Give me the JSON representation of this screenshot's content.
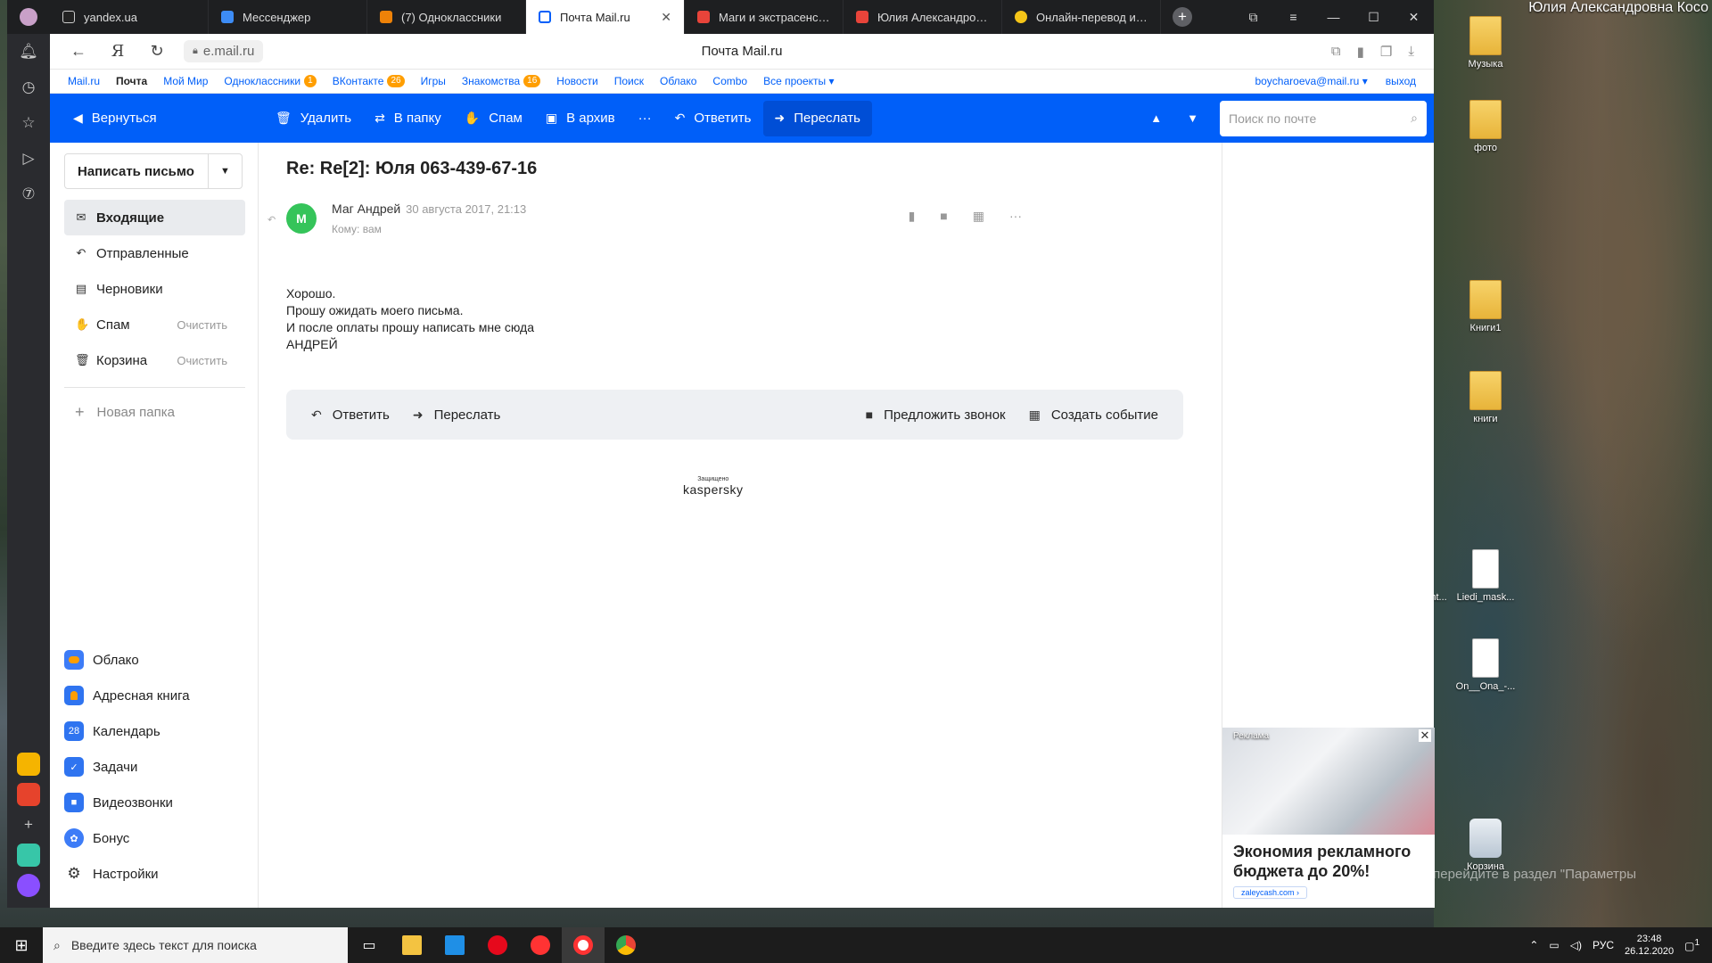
{
  "desktop": {
    "user_name": "Юлия Александровна Косо",
    "watermark": "Windows, перейдите в раздел \"Параметры",
    "icons": [
      {
        "label": "Музыка",
        "kind": "folder"
      },
      {
        "label": "фото",
        "kind": "folder"
      },
      {
        "label": "Книги1",
        "kind": "folder"
      },
      {
        "label": "книги",
        "kind": "folder"
      },
      {
        "label": "Linden_Cht...",
        "kind": "doc"
      },
      {
        "label": "Liedi_mask...",
        "kind": "doc"
      },
      {
        "label": "On__Ona_-...",
        "kind": "doc"
      },
      {
        "label": "Корзина",
        "kind": "bin"
      }
    ]
  },
  "browser": {
    "tabs": [
      {
        "label": "yandex.ua",
        "icon": "page-icon",
        "color": "#ffffff",
        "active": false
      },
      {
        "label": "Мессенджер",
        "icon": "messenger-icon",
        "color": "#3d8cf5",
        "active": false
      },
      {
        "label": "(7) Одноклассники",
        "icon": "ok-icon",
        "color": "#ee8208",
        "active": false
      },
      {
        "label": "Почта Mail.ru",
        "icon": "mail-icon",
        "color": "#005ff9",
        "active": true
      },
      {
        "label": "Маги и экстрасенсы: г",
        "icon": "site-icon",
        "color": "#e8443a",
        "active": false
      },
      {
        "label": "Юлия Александровна",
        "icon": "site-icon",
        "color": "#e8443a",
        "active": false
      },
      {
        "label": "Онлайн-перевод из к",
        "icon": "translate-icon",
        "color": "#f5c518",
        "active": false
      }
    ],
    "tab_close": "✕",
    "new_tab": "+",
    "window_controls": [
      "⧉",
      "≡",
      "—",
      "☐",
      "✕"
    ],
    "url": "e.mail.ru",
    "page_title": "Почта Mail.ru",
    "yandex_logo": "Я"
  },
  "portal": {
    "links": [
      {
        "label": "Mail.ru",
        "badge": ""
      },
      {
        "label": "Почта",
        "badge": "",
        "current": true
      },
      {
        "label": "Мой Мир",
        "badge": ""
      },
      {
        "label": "Одноклассники",
        "badge": "1"
      },
      {
        "label": "ВКонтакте",
        "badge": "26"
      },
      {
        "label": "Игры",
        "badge": ""
      },
      {
        "label": "Знакомства",
        "badge": "16"
      },
      {
        "label": "Новости",
        "badge": ""
      },
      {
        "label": "Поиск",
        "badge": ""
      },
      {
        "label": "Облако",
        "badge": ""
      },
      {
        "label": "Combo",
        "badge": ""
      },
      {
        "label": "Все проекты ▾",
        "badge": ""
      }
    ],
    "user_email": "boycharoeva@mail.ru ▾",
    "logout": "выход"
  },
  "toolbar": {
    "back": "Вернуться",
    "delete": "Удалить",
    "to_folder": "В папку",
    "spam": "Спам",
    "archive": "В архив",
    "more": "···",
    "reply": "Ответить",
    "forward": "Переслать",
    "search_placeholder": "Поиск по почте"
  },
  "sidebar": {
    "compose": "Написать письмо",
    "folders": [
      {
        "label": "Входящие",
        "icon": "inbox-icon",
        "glyph": "✉",
        "action": "",
        "active": true
      },
      {
        "label": "Отправленные",
        "icon": "sent-icon",
        "glyph": "↶",
        "action": "",
        "active": false
      },
      {
        "label": "Черновики",
        "icon": "drafts-icon",
        "glyph": "▤",
        "action": "",
        "active": false
      },
      {
        "label": "Спам",
        "icon": "spam-icon",
        "glyph": "✋",
        "action": "Очистить",
        "active": false
      },
      {
        "label": "Корзина",
        "icon": "trash-icon",
        "glyph": "🗑",
        "action": "Очистить",
        "active": false
      }
    ],
    "new_folder": "Новая папка",
    "apps": [
      {
        "label": "Облако",
        "icon": "cloud-icon",
        "color": "#3d7cf7"
      },
      {
        "label": "Адресная книга",
        "icon": "contacts-icon",
        "color": "#2f74f0"
      },
      {
        "label": "Календарь",
        "icon": "calendar-icon",
        "color": "#2f74f0",
        "glyph": "28"
      },
      {
        "label": "Задачи",
        "icon": "tasks-icon",
        "color": "#2f74f0",
        "glyph": "✓"
      },
      {
        "label": "Видеозвонки",
        "icon": "video-icon",
        "color": "#2f74f0",
        "glyph": "■"
      },
      {
        "label": "Бонус",
        "icon": "bonus-icon",
        "color": "#3d7cf7",
        "glyph": "✿"
      },
      {
        "label": "Настройки",
        "icon": "settings-icon",
        "color": "#ffffff",
        "glyph": "⚙"
      }
    ]
  },
  "message": {
    "subject": "Re: Re[2]: Юля 063-439-67-16",
    "avatar_letter": "М",
    "sender": "Маг Андрей",
    "date": "30 августа 2017, 21:13",
    "to": "Кому: вам",
    "body": [
      "Хорошо.",
      "Прошу ожидать моего письма.",
      "И после оплаты прошу написать мне сюда",
      "АНДРЕЙ"
    ],
    "actions": {
      "reply": "Ответить",
      "forward": "Переслать",
      "call": "Предложить звонок",
      "event": "Создать событие"
    },
    "protected": "Защищено",
    "kaspersky": "kaspersky"
  },
  "ad": {
    "label": "Реклама",
    "close": "✕",
    "title": "Экономия рекламного бюджета до 20%!",
    "link": "zaleycash.com ›"
  },
  "taskbar": {
    "search_placeholder": "Введите здесь текст для поиска",
    "lang": "РУС",
    "time": "23:48",
    "date": "26.12.2020",
    "notifications": "1"
  }
}
